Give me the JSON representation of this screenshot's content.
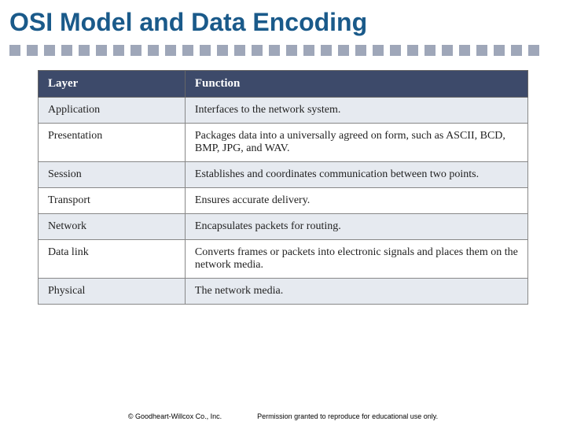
{
  "title": "OSI Model and Data Encoding",
  "table": {
    "header": {
      "col1": "Layer",
      "col2": "Function"
    },
    "rows": [
      {
        "layer": "Application",
        "function": "Interfaces to the network system."
      },
      {
        "layer": "Presentation",
        "function": "Packages data into a universally agreed on form, such as ASCII, BCD, BMP, JPG, and WAV."
      },
      {
        "layer": "Session",
        "function": "Establishes and coordinates communication between two points."
      },
      {
        "layer": "Transport",
        "function": "Ensures accurate delivery."
      },
      {
        "layer": "Network",
        "function": "Encapsulates packets for routing."
      },
      {
        "layer": "Data link",
        "function": "Converts frames or packets into electronic signals and places them on the network media."
      },
      {
        "layer": "Physical",
        "function": "The network media."
      }
    ]
  },
  "footer": {
    "copyright": "© Goodheart-Willcox Co., Inc.",
    "permission": "Permission granted to reproduce for educational use only."
  }
}
